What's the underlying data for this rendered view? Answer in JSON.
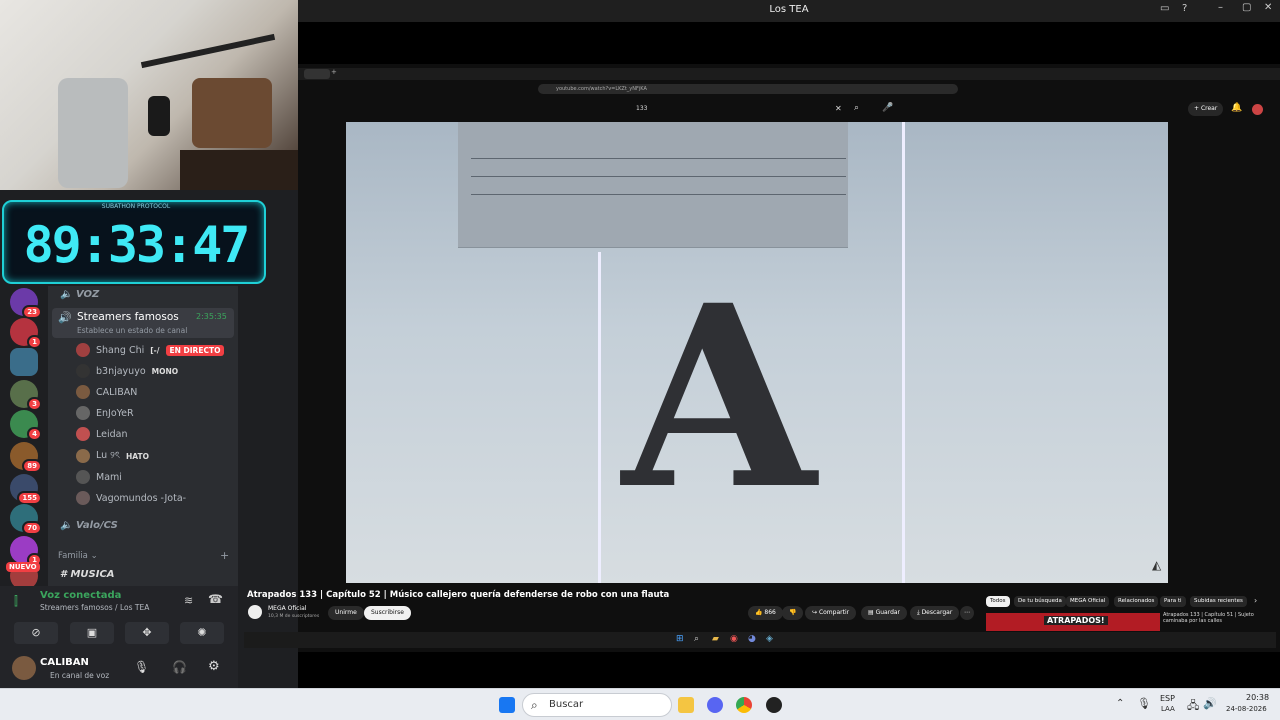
{
  "window": {
    "title": "Los TEA"
  },
  "timer": {
    "label": "SUBATHON PROTOCOL",
    "value": "89:33:47"
  },
  "guilds": [
    {
      "badge": "23",
      "color": "#6b3aa8"
    },
    {
      "badge": "1",
      "color": "#b5333f"
    },
    {
      "badge": "",
      "color": "#3a6d8a"
    },
    {
      "badge": "3",
      "color": "#586f4a"
    },
    {
      "badge": "4",
      "color": "#3b8a4f"
    },
    {
      "badge": "89",
      "color": "#8a5a2b"
    },
    {
      "badge": "155",
      "color": "#3a4a6a"
    },
    {
      "badge": "70",
      "color": "#2e6e7a"
    },
    {
      "badge": "1",
      "color": "#9b3cc4"
    },
    {
      "badge": "",
      "color": "#a33d3d"
    }
  ],
  "guild_new_label": "NUEVO",
  "channels": {
    "voice_category": "VOZ",
    "channel_name": "Streamers famosos",
    "channel_time": "2:35:35",
    "channel_status": "Establece un estado de canal",
    "users": [
      {
        "name": "Shang Chi",
        "tag": "[-/",
        "live": "EN DIRECTO"
      },
      {
        "name": "b3njayuyo",
        "tag": "MONO",
        "live": ""
      },
      {
        "name": "CALIBAN",
        "tag": "",
        "live": ""
      },
      {
        "name": "EnJoYeR",
        "tag": "",
        "live": ""
      },
      {
        "name": "Leidan",
        "tag": "",
        "live": ""
      },
      {
        "name": "Lu ୨ৎ",
        "tag": "HATO",
        "live": ""
      },
      {
        "name": "Mami",
        "tag": "",
        "live": ""
      },
      {
        "name": "Vagomundos -Jota-",
        "tag": "",
        "live": ""
      }
    ],
    "valo_channel": "Valo/CS",
    "family_category": "Familia",
    "music_channel": "MUSICA"
  },
  "voice_panel": {
    "status": "Voz conectada",
    "location": "Streamers famosos / Los TEA",
    "username": "CALIBAN",
    "user_status": "En canal de voz"
  },
  "browser": {
    "url": "youtube.com/watch?v=LKZt_yNFjKA",
    "search_value": "133",
    "create_label": "Crear"
  },
  "video": {
    "overlay_letter": "A",
    "title": "Atrapados 133 | Capítulo 52 | Músico callejero quería defenderse de robo con una flauta",
    "channel": "MEGA Oficial",
    "subscribers": "10,3 M de suscriptores",
    "join_label": "Unirme",
    "subscribe_label": "Suscribirse",
    "likes": "866",
    "share_label": "Compartir",
    "save_label": "Guardar",
    "download_label": "Descargar"
  },
  "chips": [
    "Todos",
    "De tu búsqueda",
    "MEGA Oficial",
    "Relacionados",
    "Para ti",
    "Subidas recientes"
  ],
  "suggestion": {
    "title": "Atrapados 133 | Capítulo 51 | Sujeto caminaba por las calles",
    "thumb_text": "ATRAPADOS!"
  },
  "taskbar": {
    "search_placeholder": "Buscar",
    "lang": "ESP",
    "lang_sub": "LAA",
    "time": "20:38",
    "date": "24-08-2026"
  }
}
